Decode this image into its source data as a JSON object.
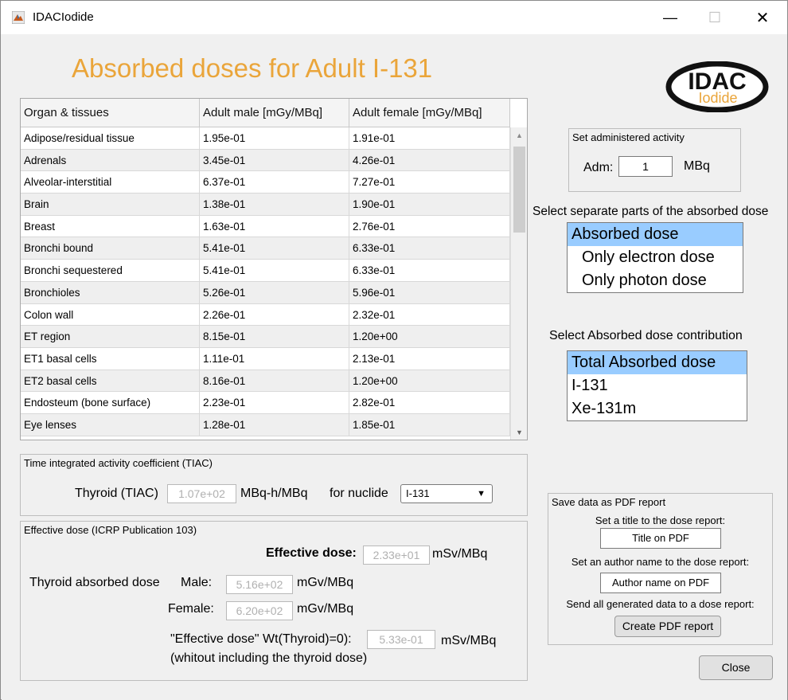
{
  "window": {
    "title": "IDACIodide"
  },
  "heading": "Absorbed doses for Adult I-131",
  "logo": {
    "line1": "IDAC",
    "line2": "Iodide"
  },
  "table": {
    "headers": [
      "Organ & tissues",
      "Adult male [mGy/MBq]",
      "Adult female [mGy/MBq]"
    ],
    "rows": [
      [
        "Adipose/residual tissue",
        "1.95e-01",
        "1.91e-01"
      ],
      [
        "Adrenals",
        "3.45e-01",
        "4.26e-01"
      ],
      [
        "Alveolar-interstitial",
        "6.37e-01",
        "7.27e-01"
      ],
      [
        "Brain",
        "1.38e-01",
        "1.90e-01"
      ],
      [
        "Breast",
        "1.63e-01",
        "2.76e-01"
      ],
      [
        "Bronchi bound",
        "5.41e-01",
        "6.33e-01"
      ],
      [
        "Bronchi sequestered",
        "5.41e-01",
        "6.33e-01"
      ],
      [
        "Bronchioles",
        "5.26e-01",
        "5.96e-01"
      ],
      [
        "Colon wall",
        "2.26e-01",
        "2.32e-01"
      ],
      [
        "ET region",
        "8.15e-01",
        "1.20e+00"
      ],
      [
        "ET1 basal cells",
        "1.11e-01",
        "2.13e-01"
      ],
      [
        "ET2 basal cells",
        "8.16e-01",
        "1.20e+00"
      ],
      [
        "Endosteum (bone surface)",
        "2.23e-01",
        "2.82e-01"
      ],
      [
        "Eye lenses",
        "1.28e-01",
        "1.85e-01"
      ]
    ]
  },
  "activity": {
    "title": "Set administered activity",
    "label": "Adm:",
    "value": "1",
    "unit": "MBq"
  },
  "parts": {
    "label": "Select separate parts of the absorbed dose",
    "items": [
      "Absorbed dose",
      "Only electron dose",
      "Only photon dose"
    ],
    "selected_index": 0
  },
  "contribution": {
    "label": "Select Absorbed dose contribution",
    "items": [
      "Total Absorbed dose",
      "I-131",
      "Xe-131m"
    ],
    "selected_index": 0
  },
  "tiac": {
    "title": "Time integrated activity coefficient (TIAC)",
    "label": "Thyroid (TIAC)",
    "value": "1.07e+02",
    "unit": "MBq-h/MBq",
    "nuclide_label": "for nuclide",
    "nuclide_value": "I-131"
  },
  "effective": {
    "title": "Effective dose (ICRP Publication 103)",
    "effective_label": "Effective dose:",
    "effective_value": "2.33e+01",
    "effective_unit": "mSv/MBq",
    "thyroid_label": "Thyroid absorbed dose",
    "male_label": "Male:",
    "male_value": "5.16e+02",
    "male_unit": "mGv/MBq",
    "female_label": "Female:",
    "female_value": "6.20e+02",
    "female_unit": "mGv/MBq",
    "wt_label": "\"Effective dose\" Wt(Thyroid)=0):",
    "wt_value": "5.33e-01",
    "wt_unit": "mSv/MBq",
    "wt_note": "(whitout including the thyroid dose)"
  },
  "pdf": {
    "title": "Save data as PDF report",
    "title_prompt": "Set a title to the dose report:",
    "title_value": "Title on PDF",
    "author_prompt": "Set an author name to the dose report:",
    "author_value": "Author name on PDF",
    "send_prompt": "Send all generated data to a dose report:",
    "create_label": "Create PDF report"
  },
  "close_label": "Close",
  "colors": {
    "heading": "#eaa53a",
    "selection": "#99ccff"
  }
}
